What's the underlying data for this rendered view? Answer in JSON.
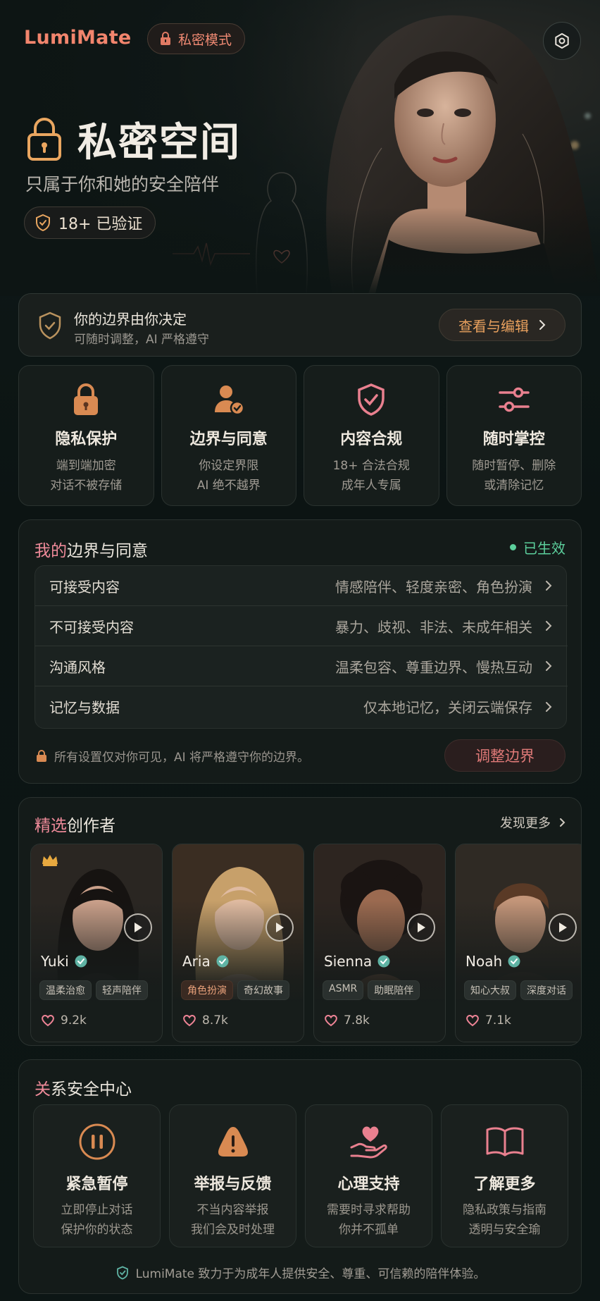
{
  "header": {
    "brand": "LumiMate",
    "private_mode_label": "私密模式",
    "settings_icon": "gear-icon"
  },
  "hero": {
    "title": "私密空间",
    "subtitle": "只属于你和她的安全陪伴",
    "verified_label": "18+ 已验证"
  },
  "boundary_banner": {
    "title": "你的边界由你决定",
    "subtitle": "可随时调整，AI 严格遵守",
    "button_label": "查看与编辑"
  },
  "features": [
    {
      "icon": "lock-icon",
      "title": "隐私保护",
      "line1": "端到端加密",
      "line2": "对话不被存储"
    },
    {
      "icon": "user-check-icon",
      "title": "边界与同意",
      "line1": "你设定界限",
      "line2": "AI 绝不越界"
    },
    {
      "icon": "shield-check-icon",
      "title": "内容合规",
      "line1": "18+ 合法合规",
      "line2": "成年人专属"
    },
    {
      "icon": "sliders-icon",
      "title": "随时掌控",
      "line1": "随时暂停、删除",
      "line2": "或清除记忆"
    }
  ],
  "my_boundaries": {
    "title_accent": "我的",
    "title_rest": "边界与同意",
    "status": "已生效",
    "rows": [
      {
        "label": "可接受内容",
        "value": "情感陪伴、轻度亲密、角色扮演"
      },
      {
        "label": "不可接受内容",
        "value": "暴力、歧视、非法、未成年相关"
      },
      {
        "label": "沟通风格",
        "value": "温柔包容、尊重边界、慢热互动"
      },
      {
        "label": "记忆与数据",
        "value": "仅本地记忆，关闭云端保存"
      }
    ],
    "footer_note": "所有设置仅对你可见，AI 将严格遵守你的边界。",
    "adjust_button": "调整边界"
  },
  "creators": {
    "title_accent": "精选",
    "title_rest": "创作者",
    "more_label": "发现更多",
    "items": [
      {
        "name": "Yuki",
        "tags": [
          "温柔治愈",
          "轻声陪伴"
        ],
        "likes": "9.2k",
        "featured": true
      },
      {
        "name": "Aria",
        "tags": [
          "角色扮演",
          "奇幻故事"
        ],
        "likes": "8.7k",
        "featured": false
      },
      {
        "name": "Sienna",
        "tags": [
          "ASMR",
          "助眠陪伴"
        ],
        "likes": "7.8k",
        "featured": false
      },
      {
        "name": "Noah",
        "tags": [
          "知心大叔",
          "深度对话"
        ],
        "likes": "7.1k",
        "featured": false
      }
    ]
  },
  "safety_center": {
    "title_accent": "关",
    "title_rest": "系安全中心",
    "cards": [
      {
        "icon": "pause-icon",
        "title": "紧急暂停",
        "line1": "立即停止对话",
        "line2": "保护你的状态"
      },
      {
        "icon": "warning-icon",
        "title": "举报与反馈",
        "line1": "不当内容举报",
        "line2": "我们会及时处理"
      },
      {
        "icon": "heart-hand-icon",
        "title": "心理支持",
        "line1": "需要时寻求帮助",
        "line2": "你并不孤单"
      },
      {
        "icon": "book-icon",
        "title": "了解更多",
        "line1": "隐私政策与指南",
        "line2": "透明与安全瑜"
      }
    ],
    "footer": "LumiMate 致力于为成年人提供安全、尊重、可信赖的陪伴体验。"
  },
  "colors": {
    "brand": "#f2856d",
    "accent_pink": "#f08b9a",
    "accent_orange": "#e9a15e",
    "status_green": "#5ccf9c",
    "background": "#0d1514"
  }
}
